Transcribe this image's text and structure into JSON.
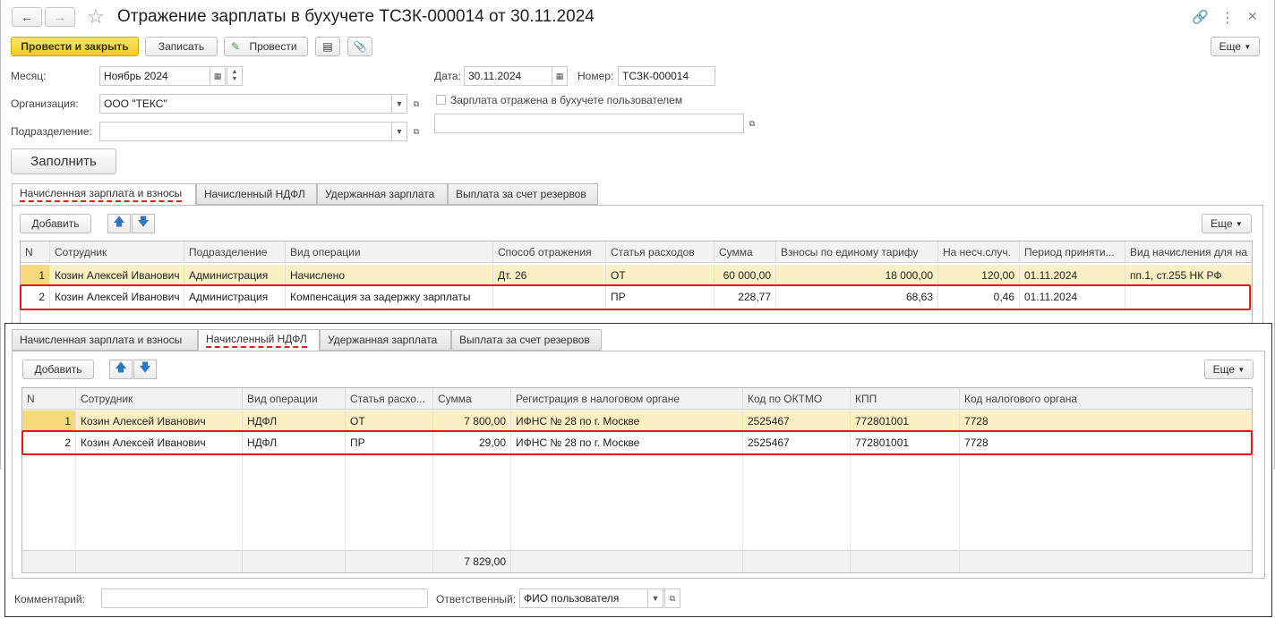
{
  "window": {
    "title": "Отражение зарплаты в бухучете ТСЗК-000014 от 30.11.2024",
    "back_icon": "arrow-left-icon",
    "forward_icon": "arrow-right-icon",
    "more_icon": "more-dots-icon",
    "close_icon": "close-icon"
  },
  "toolbar": {
    "post_close": "Провести и закрыть",
    "save": "Записать",
    "post": "Провести",
    "more": "Еще"
  },
  "form": {
    "month_label": "Месяц:",
    "month_value": "Ноябрь 2024",
    "date_label": "Дата:",
    "date_value": "30.11.2024",
    "number_label": "Номер:",
    "number_value": "ТСЗК-000014",
    "org_label": "Организация:",
    "org_value": "ООО \"ТЕКС\"",
    "dept_label": "Подразделение:",
    "dept_value": "",
    "reflected_label": "Зарплата отражена в бухучете пользователем",
    "fill_button": "Заполнить"
  },
  "tabs": [
    "Начисленная зарплата и взносы",
    "Начисленный НДФЛ",
    "Удержанная зарплата",
    "Выплата за счет резервов"
  ],
  "grid1": {
    "add": "Добавить",
    "more": "Еще",
    "columns": [
      "N",
      "Сотрудник",
      "Подразделение",
      "Вид операции",
      "Способ отражения",
      "Статья расходов",
      "Сумма",
      "Взносы по единому тарифу",
      "На несч.случ.",
      "Период приняти...",
      "Вид начисления для на"
    ],
    "rows": [
      [
        "1",
        "Козин Алексей Иванович",
        "Администрация",
        "Начислено",
        "Дт. 26",
        "ОТ",
        "60 000,00",
        "18 000,00",
        "120,00",
        "01.11.2024",
        "пп.1, ст.255 НК РФ"
      ],
      [
        "2",
        "Козин Алексей Иванович",
        "Администрация",
        "Компенсация за задержку зарплаты",
        "",
        "ПР",
        "228,77",
        "68,63",
        "0,46",
        "01.11.2024",
        ""
      ]
    ]
  },
  "grid2": {
    "add": "Добавить",
    "more": "Еще",
    "columns": [
      "N",
      "Сотрудник",
      "Вид операции",
      "Статья расхо...",
      "Сумма",
      "Регистрация в налоговом органе",
      "Код по ОКТМО",
      "КПП",
      "Код налогового органа"
    ],
    "rows": [
      [
        "1",
        "Козин Алексей Иванович",
        "НДФЛ",
        "ОТ",
        "7 800,00",
        "ИФНС № 28 по  г. Москве",
        "2525467",
        "772801001",
        "7728"
      ],
      [
        "2",
        "Козин Алексей Иванович",
        "НДФЛ",
        "ПР",
        "29,00",
        "ИФНС № 28 по  г. Москве",
        "2525467",
        "772801001",
        "7728"
      ]
    ],
    "total": "7 829,00"
  },
  "footer": {
    "comment_label": "Комментарий:",
    "comment_value": "",
    "responsible_label": "Ответственный:",
    "responsible_value": "ФИО пользователя"
  }
}
